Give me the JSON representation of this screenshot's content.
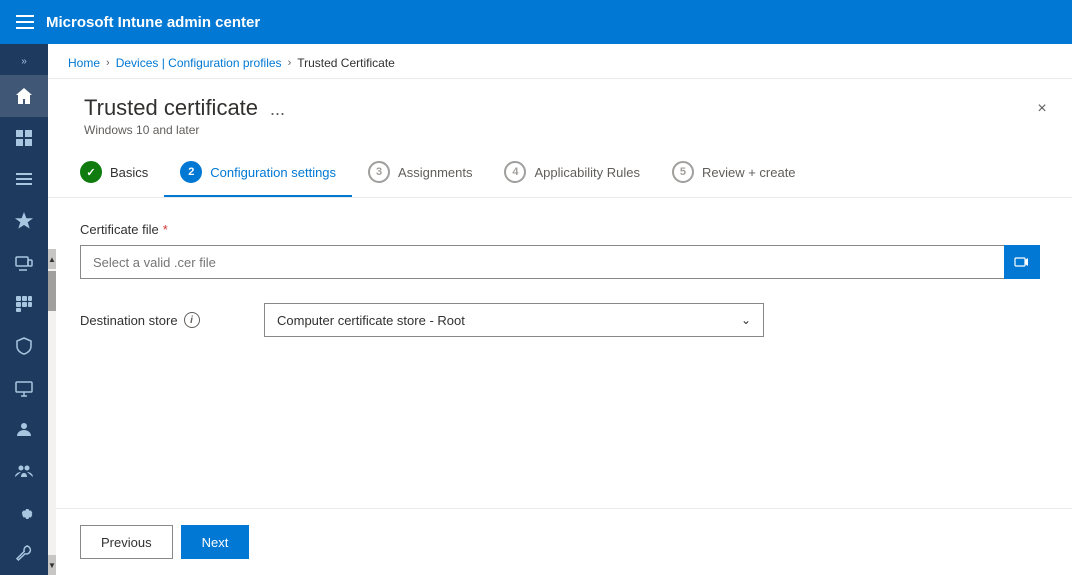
{
  "topbar": {
    "title": "Microsoft Intune admin center"
  },
  "breadcrumb": {
    "home": "Home",
    "devices": "Devices | Configuration profiles",
    "current": "Trusted Certificate"
  },
  "panel": {
    "title": "Trusted certificate",
    "subtitle": "Windows 10 and later",
    "menu_btn": "...",
    "close_label": "×"
  },
  "wizard": {
    "steps": [
      {
        "id": "basics",
        "num": "1",
        "label": "Basics",
        "state": "completed"
      },
      {
        "id": "config",
        "num": "2",
        "label": "Configuration settings",
        "state": "active"
      },
      {
        "id": "assignments",
        "num": "3",
        "label": "Assignments",
        "state": "inactive"
      },
      {
        "id": "applicability",
        "num": "4",
        "label": "Applicability Rules",
        "state": "inactive"
      },
      {
        "id": "review",
        "num": "5",
        "label": "Review + create",
        "state": "inactive"
      }
    ]
  },
  "form": {
    "certificate_file_label": "Certificate file",
    "certificate_file_placeholder": "Select a valid .cer file",
    "destination_store_label": "Destination store",
    "destination_store_value": "Computer certificate store - Root",
    "info_icon_label": "i"
  },
  "footer": {
    "previous_label": "Previous",
    "next_label": "Next"
  },
  "sidebar": {
    "items": [
      {
        "id": "home",
        "icon": "home"
      },
      {
        "id": "dashboard",
        "icon": "dashboard"
      },
      {
        "id": "list",
        "icon": "list"
      },
      {
        "id": "star",
        "icon": "star"
      },
      {
        "id": "devices",
        "icon": "devices"
      },
      {
        "id": "apps",
        "icon": "apps"
      },
      {
        "id": "security",
        "icon": "security"
      },
      {
        "id": "monitor",
        "icon": "monitor"
      },
      {
        "id": "users",
        "icon": "users"
      },
      {
        "id": "groups",
        "icon": "groups"
      },
      {
        "id": "settings",
        "icon": "settings"
      },
      {
        "id": "tools",
        "icon": "tools"
      }
    ]
  }
}
